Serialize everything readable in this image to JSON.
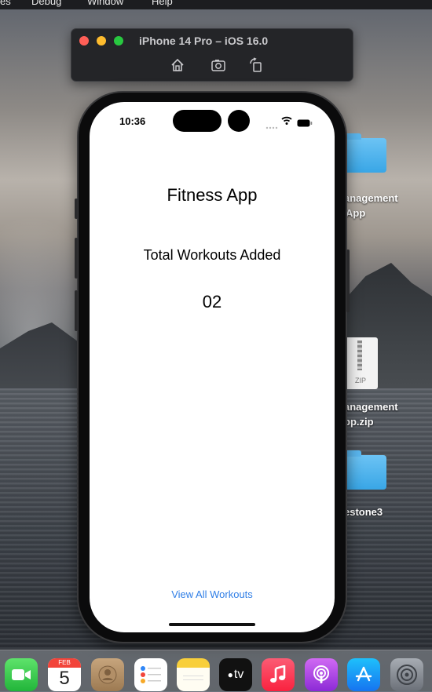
{
  "menubar": {
    "items": [
      "es",
      "Debug",
      "Window",
      "Help"
    ]
  },
  "simulator": {
    "title": "iPhone 14 Pro – iOS 16.0",
    "window_controls": [
      "close",
      "minimize",
      "zoom"
    ],
    "toolbar": [
      "home-icon",
      "screenshot-icon",
      "rotate-icon"
    ]
  },
  "desktop": {
    "items": [
      {
        "label_line1": "anagement",
        "label_line2": "App",
        "icon": "folder-icon"
      },
      {
        "label_line1": "anagement",
        "label_line2": "pp.zip",
        "icon": "zip-file-icon",
        "badge": "ZIP"
      },
      {
        "label_line1": "estone3",
        "icon": "folder-icon"
      }
    ]
  },
  "phone": {
    "status_bar": {
      "time": "10:36"
    },
    "app": {
      "title": "Fitness App",
      "subtitle": "Total Workouts Added",
      "count": "02",
      "link": "View All Workouts"
    }
  },
  "dock": {
    "apps": [
      {
        "name": "FaceTime",
        "icon": "facetime-icon"
      },
      {
        "name": "Calendar",
        "icon": "calendar-icon",
        "month": "FEB",
        "day": "5"
      },
      {
        "name": "Contacts",
        "icon": "contacts-icon"
      },
      {
        "name": "Reminders",
        "icon": "reminders-icon"
      },
      {
        "name": "Notes",
        "icon": "notes-icon"
      },
      {
        "name": "TV",
        "icon": "apple-tv-icon",
        "label": "tv"
      },
      {
        "name": "Music",
        "icon": "music-icon"
      },
      {
        "name": "Podcasts",
        "icon": "podcasts-icon"
      },
      {
        "name": "App Store",
        "icon": "app-store-icon"
      },
      {
        "name": "System Settings",
        "icon": "settings-icon"
      }
    ]
  },
  "colors": {
    "link_blue": "#2f7ee6",
    "close": "#ff5f57",
    "minimize": "#febc2e",
    "zoom": "#28c840",
    "folder_blue": "#39a6e6"
  }
}
